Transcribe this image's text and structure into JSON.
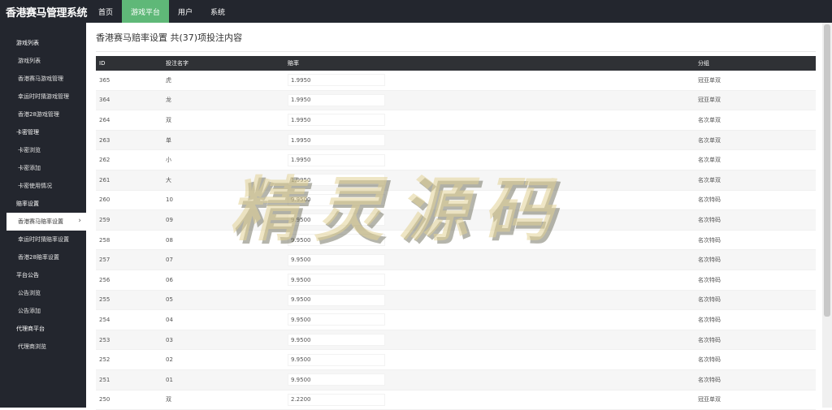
{
  "header": {
    "brand": "香港赛马管理系统",
    "nav": [
      "首页",
      "游戏平台",
      "用户",
      "系统"
    ],
    "active_nav": 1
  },
  "sidebar": {
    "sections": [
      {
        "title": "游戏列表",
        "items": [
          "游戏列表",
          "香港赛马游戏管理",
          "幸运时时猜游戏管理",
          "香港28游戏管理"
        ]
      },
      {
        "title": "卡密管理",
        "items": [
          "卡密浏览",
          "卡密添加",
          "卡密使用情况"
        ]
      },
      {
        "title": "赔率设置",
        "items": [
          "香港赛马赔率设置",
          "幸运时时猜赔率设置",
          "香港28赔率设置"
        ]
      },
      {
        "title": "平台公告",
        "items": [
          "公告浏览",
          "公告添加"
        ]
      },
      {
        "title": "代理商平台",
        "items": [
          "代理商浏览"
        ]
      }
    ],
    "active_item": "香港赛马赔率设置"
  },
  "main": {
    "title": "香港赛马赔率设置 共(37)项投注内容",
    "table": {
      "headers": [
        "ID",
        "投注名字",
        "赔率",
        "分组"
      ],
      "rows": [
        [
          "365",
          "虎",
          "1.9950",
          "冠亚单双"
        ],
        [
          "364",
          "龙",
          "1.9950",
          "冠亚单双"
        ],
        [
          "264",
          "双",
          "1.9950",
          "名次单双"
        ],
        [
          "263",
          "单",
          "1.9950",
          "名次单双"
        ],
        [
          "262",
          "小",
          "1.9950",
          "名次单双"
        ],
        [
          "261",
          "大",
          "1.9950",
          "名次单双"
        ],
        [
          "260",
          "10",
          "9.9500",
          "名次特码"
        ],
        [
          "259",
          "09",
          "9.9500",
          "名次特码"
        ],
        [
          "258",
          "08",
          "9.9500",
          "名次特码"
        ],
        [
          "257",
          "07",
          "9.9500",
          "名次特码"
        ],
        [
          "256",
          "06",
          "9.9500",
          "名次特码"
        ],
        [
          "255",
          "05",
          "9.9500",
          "名次特码"
        ],
        [
          "254",
          "04",
          "9.9500",
          "名次特码"
        ],
        [
          "253",
          "03",
          "9.9500",
          "名次特码"
        ],
        [
          "252",
          "02",
          "9.9500",
          "名次特码"
        ],
        [
          "251",
          "01",
          "9.9500",
          "名次特码"
        ],
        [
          "250",
          "双",
          "2.2200",
          "冠亚单双"
        ]
      ]
    }
  },
  "watermark": "精灵源码",
  "colors": {
    "topbar": "#23262e",
    "accent": "#5fb878",
    "table_header": "#2f3135"
  }
}
